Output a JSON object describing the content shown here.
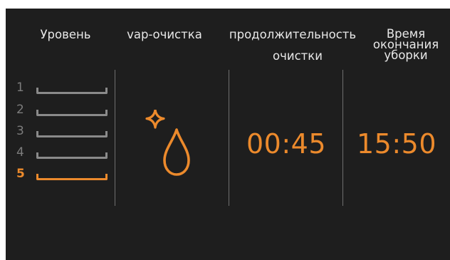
{
  "headers": {
    "level": "Уровень",
    "vap": "vap-очистка",
    "duration_line1": "продолжительность",
    "duration_line2": "очистки",
    "end_line1": "Время",
    "end_line2": "окончания",
    "end_line3": "уборки"
  },
  "levels": [
    {
      "number": "1",
      "active": false
    },
    {
      "number": "2",
      "active": false
    },
    {
      "number": "3",
      "active": false
    },
    {
      "number": "4",
      "active": false
    },
    {
      "number": "5",
      "active": true
    }
  ],
  "vap_icon": "sparkle-water-drop-icon",
  "duration_value": "00:45",
  "end_time_value": "15:50",
  "colors": {
    "background": "#1e1e1e",
    "accent": "#ec8a2c",
    "text": "#e8e8e8",
    "inactive": "#8a8a8a"
  }
}
